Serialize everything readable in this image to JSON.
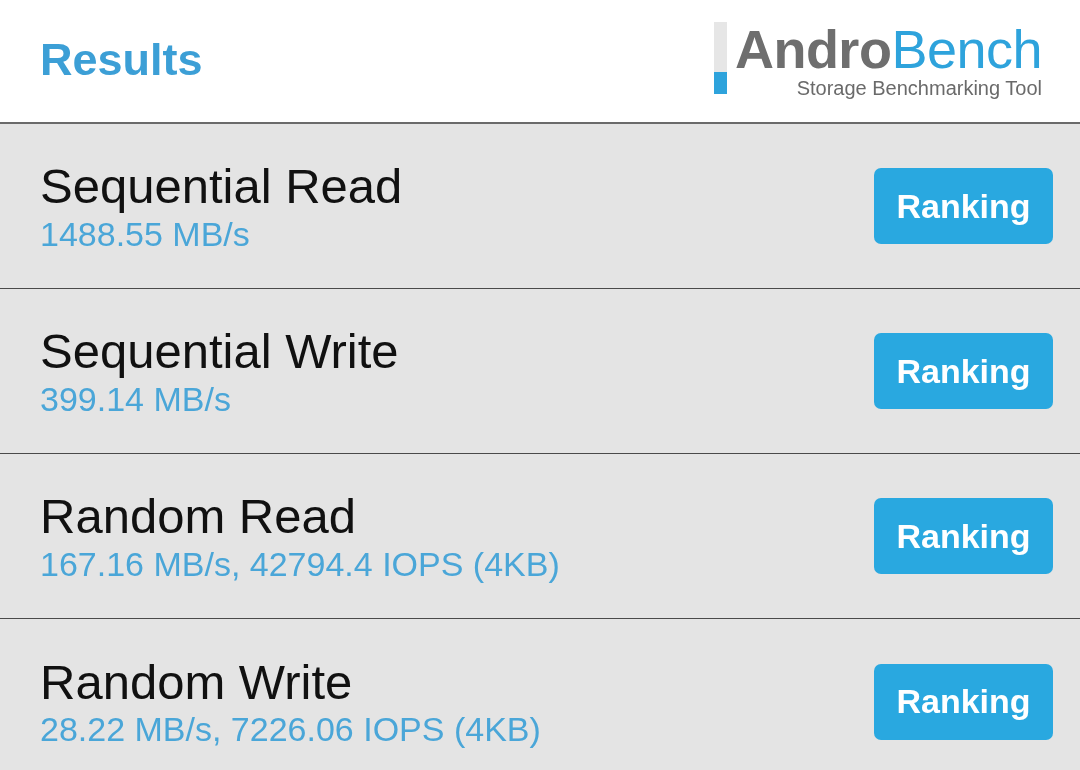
{
  "header": {
    "title": "Results",
    "logo": {
      "wordmark": [
        {
          "text": "Andro",
          "color": "#6e6e6e"
        },
        {
          "text": "Bench",
          "color": "#2ea3dc"
        }
      ],
      "tagline": "Storage Benchmarking Tool"
    }
  },
  "results": [
    {
      "name": "Sequential Read",
      "value": "1488.55 MB/s",
      "button": "Ranking"
    },
    {
      "name": "Sequential Write",
      "value": "399.14 MB/s",
      "button": "Ranking"
    },
    {
      "name": "Random Read",
      "value": "167.16 MB/s, 42794.4 IOPS (4KB)",
      "button": "Ranking"
    },
    {
      "name": "Random Write",
      "value": "28.22 MB/s, 7226.06 IOPS (4KB)",
      "button": "Ranking"
    }
  ]
}
